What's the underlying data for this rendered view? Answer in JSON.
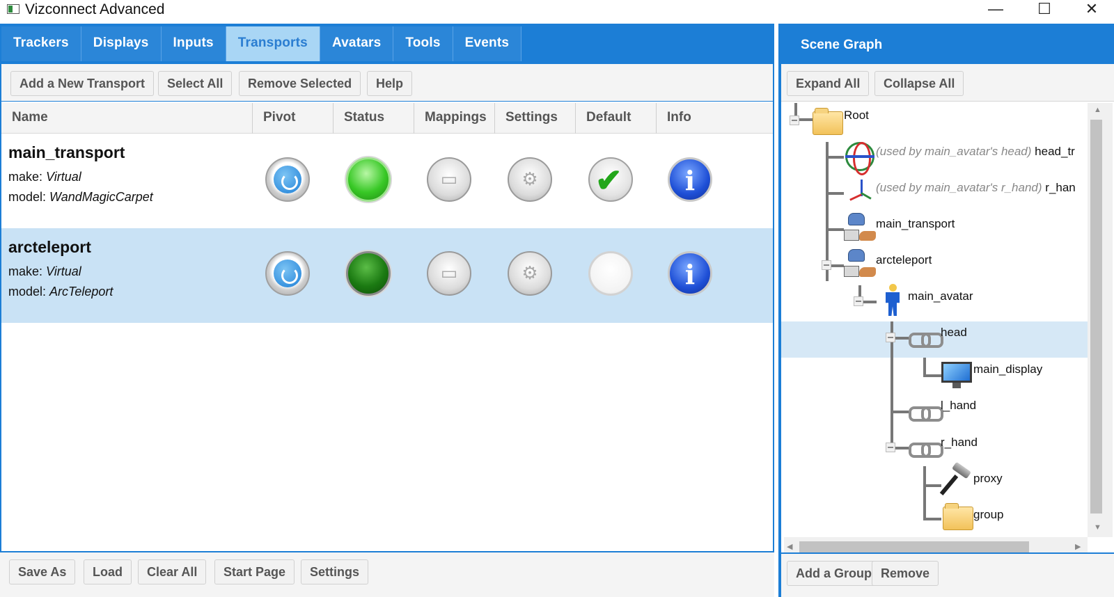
{
  "window": {
    "title": "Vizconnect Advanced",
    "minimize": "—",
    "maximize": "☐",
    "close": "✕"
  },
  "tabs": [
    "Trackers",
    "Displays",
    "Inputs",
    "Transports",
    "Avatars",
    "Tools",
    "Events"
  ],
  "active_tab": "Transports",
  "toolbar": {
    "add": "Add a New Transport",
    "select_all": "Select All",
    "remove_selected": "Remove Selected",
    "help": "Help"
  },
  "columns": [
    "Name",
    "Pivot",
    "Status",
    "Mappings",
    "Settings",
    "Default",
    "Info"
  ],
  "transports": [
    {
      "name": "main_transport",
      "make_label": "make:",
      "make": "Virtual",
      "model_label": "model:",
      "model": "WandMagicCarpet",
      "status": "active",
      "default": true,
      "selected": false
    },
    {
      "name": "arcteleport",
      "make_label": "make:",
      "make": "Virtual",
      "model_label": "model:",
      "model": "ArcTeleport",
      "status": "inactive",
      "default": false,
      "selected": true
    }
  ],
  "bottom_toolbar": {
    "save_as": "Save As",
    "load": "Load",
    "clear_all": "Clear All",
    "start_page": "Start Page",
    "settings": "Settings"
  },
  "scene_graph": {
    "title": "Scene Graph",
    "expand_all": "Expand All",
    "collapse_all": "Collapse All",
    "nodes": {
      "root": "Root",
      "head_tracker_prefix": "(used by main_avatar's head)",
      "head_tracker_name": "head_tr",
      "rhand_tracker_prefix": "(used by main_avatar's r_hand)",
      "rhand_tracker_name": "r_han",
      "main_transport": "main_transport",
      "arcteleport": "arcteleport",
      "main_avatar": "main_avatar",
      "head": "head",
      "main_display": "main_display",
      "l_hand": "l_hand",
      "r_hand": "r_hand",
      "proxy": "proxy",
      "group": "group"
    },
    "selected_node": "head",
    "add_group": "Add a Group",
    "remove": "Remove"
  },
  "icons": {
    "pivot": "pivot-refresh-icon",
    "status_on": "status-green-icon",
    "mappings": "mappings-icon",
    "settings": "gear-icon",
    "default": "checkmark-icon",
    "info": "info-icon"
  },
  "colors": {
    "accent": "#1c7ed6",
    "active_tab_bg": "#a9d6f5",
    "selected_row": "#c9e2f5"
  }
}
